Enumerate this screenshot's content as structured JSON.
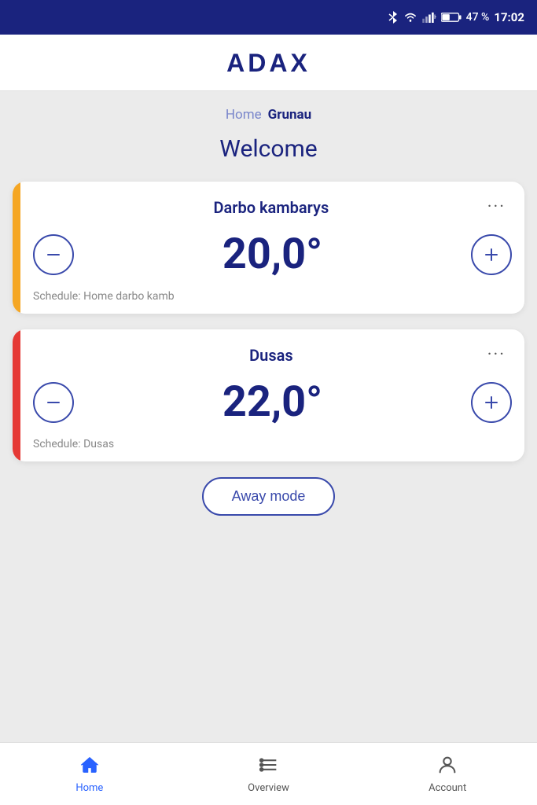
{
  "statusBar": {
    "battery": "47 %",
    "time": "17:02"
  },
  "header": {
    "logo": "ADAX"
  },
  "breadcrumb": {
    "home": "Home",
    "current": "Grunau"
  },
  "welcome": "Welcome",
  "devices": [
    {
      "id": "darbo-kambarys",
      "name": "Darbo kambarys",
      "temperature": "20,0°",
      "schedule": "Schedule: Home darbo kamb",
      "indicatorColor": "yellow",
      "menuLabel": "···"
    },
    {
      "id": "dusas",
      "name": "Dusas",
      "temperature": "22,0°",
      "schedule": "Schedule: Dusas",
      "indicatorColor": "orange",
      "menuLabel": "···"
    }
  ],
  "awayButton": "Away mode",
  "nav": {
    "items": [
      {
        "id": "home",
        "label": "Home",
        "active": true
      },
      {
        "id": "overview",
        "label": "Overview",
        "active": false
      },
      {
        "id": "account",
        "label": "Account",
        "active": false
      }
    ]
  }
}
